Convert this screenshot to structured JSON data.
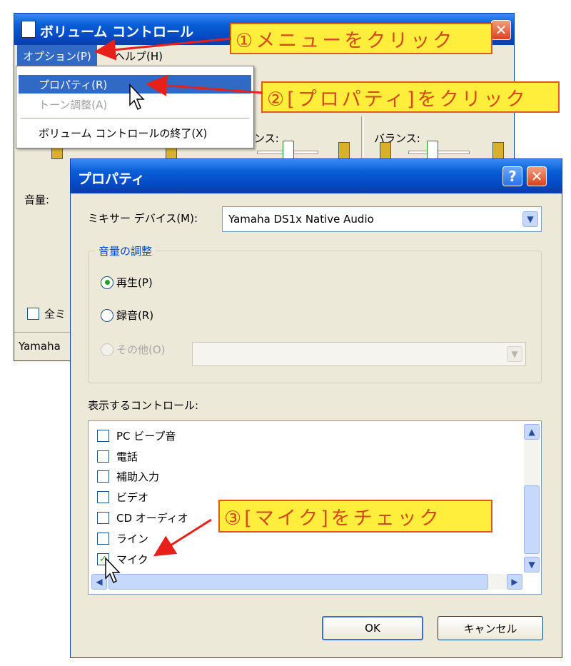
{
  "volume_window": {
    "title": "ボリューム コントロール",
    "menu": {
      "options": "オプション(P)",
      "help": "ヘルプ(H)"
    },
    "dropdown": {
      "properties": "プロパティ(R)",
      "tone": "トーン調整(A)",
      "exit": "ボリューム コントロールの終了(X)"
    },
    "volume_label": "音量:",
    "balance_label": "バランス:",
    "balance_fragment": "ンス:",
    "mute_all_fragment": "全ミ",
    "status_fragment": "Yamaha"
  },
  "properties_dialog": {
    "title": "プロパティ",
    "mixer_label": "ミキサー デバイス(M):",
    "mixer_value": "Yamaha DS1x Native Audio",
    "group_label": "音量の調整",
    "radio_playback": "再生(P)",
    "radio_record": "録音(R)",
    "radio_other": "その他(O)",
    "controls_label": "表示するコントロール:",
    "controls": [
      {
        "label": "PC ビープ音",
        "checked": false
      },
      {
        "label": "電話",
        "checked": false
      },
      {
        "label": "補助入力",
        "checked": false
      },
      {
        "label": "ビデオ",
        "checked": false
      },
      {
        "label": "CD オーディオ",
        "checked": false
      },
      {
        "label": "ライン",
        "checked": false
      },
      {
        "label": "マイク",
        "checked": true
      }
    ],
    "ok": "OK",
    "cancel": "キャンセル"
  },
  "annotations": {
    "step1": "①メニューをクリック",
    "step2": "②[プロパティ]をクリック",
    "step3": "③[マイク]をチェック"
  },
  "colors": {
    "annotation_bg": "#ffef3c",
    "annotation_text": "#d2491a",
    "arrow": "#e8201a",
    "xp_blue": "#0a5fd8"
  }
}
